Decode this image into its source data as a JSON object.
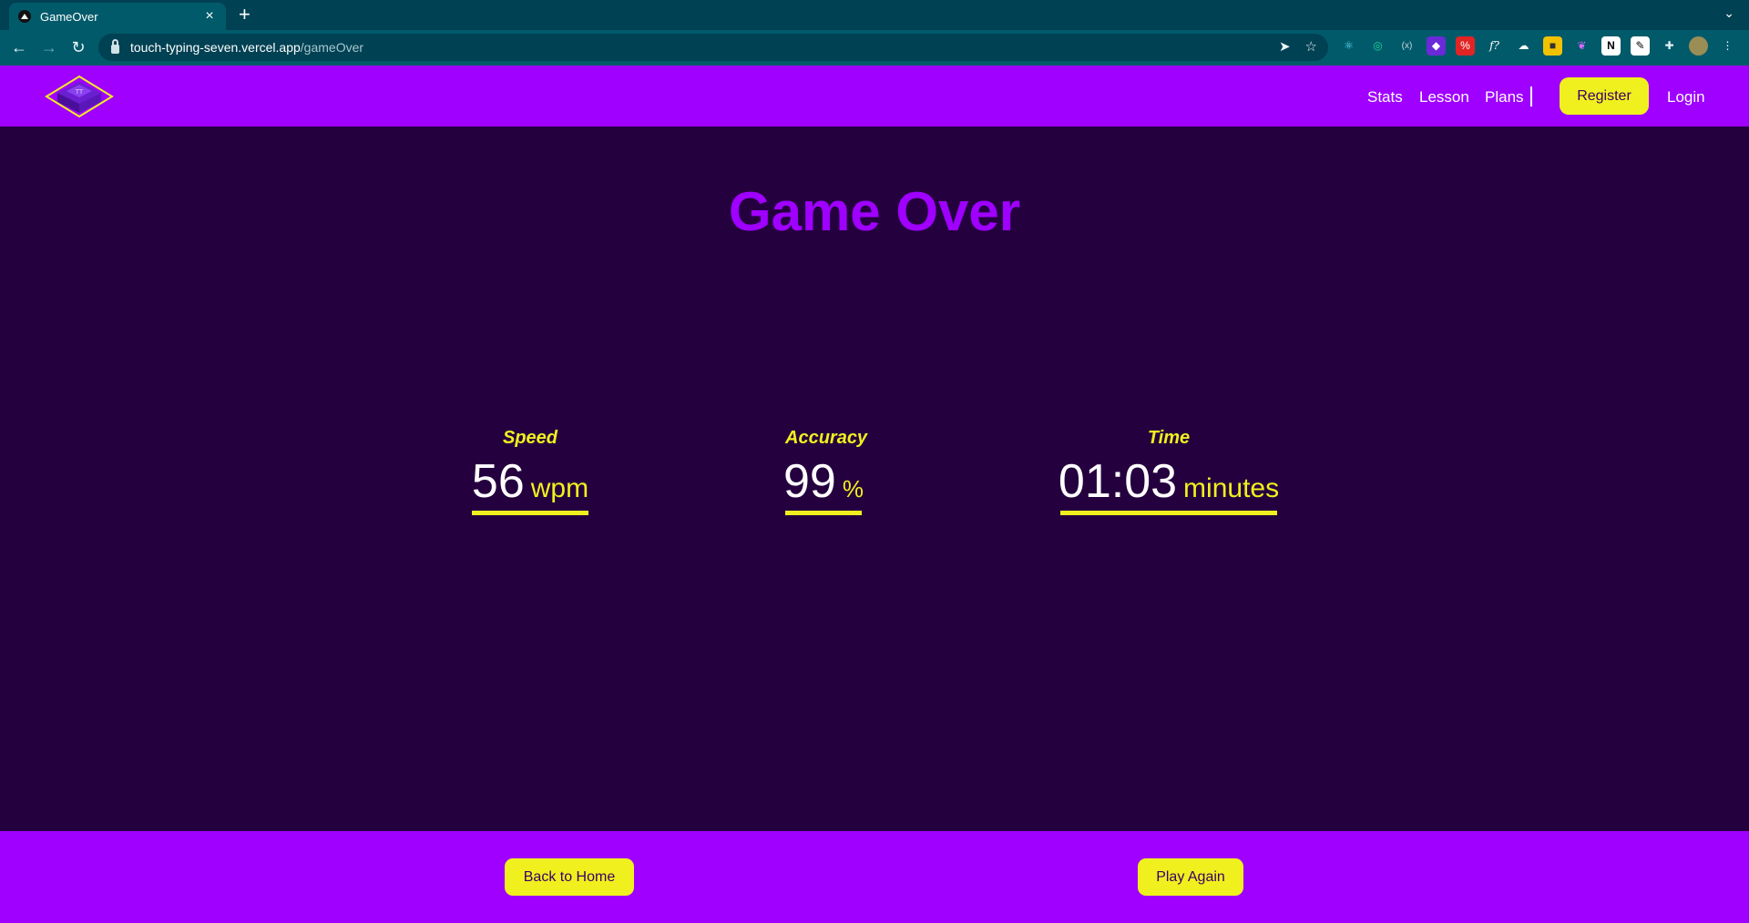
{
  "browser": {
    "tab_title": "GameOver",
    "url_host": "touch-typing-seven.vercel.app",
    "url_path": "/gameOver"
  },
  "header": {
    "nav": [
      "Stats",
      "Lesson",
      "Plans"
    ],
    "register_label": "Register",
    "login_label": "Login"
  },
  "main": {
    "title": "Game Over",
    "stats": [
      {
        "label": "Speed",
        "value": "56",
        "unit": "wpm"
      },
      {
        "label": "Accuracy",
        "value": "99",
        "unit": "%"
      },
      {
        "label": "Time",
        "value": "01:03",
        "unit": "minutes"
      }
    ]
  },
  "footer": {
    "back_label": "Back to Home",
    "play_again_label": "Play Again"
  },
  "colors": {
    "header_bg": "#9f00ff",
    "page_bg": "#25003f",
    "accent_yellow": "#f0f01f",
    "title_purple": "#9f00ff"
  }
}
